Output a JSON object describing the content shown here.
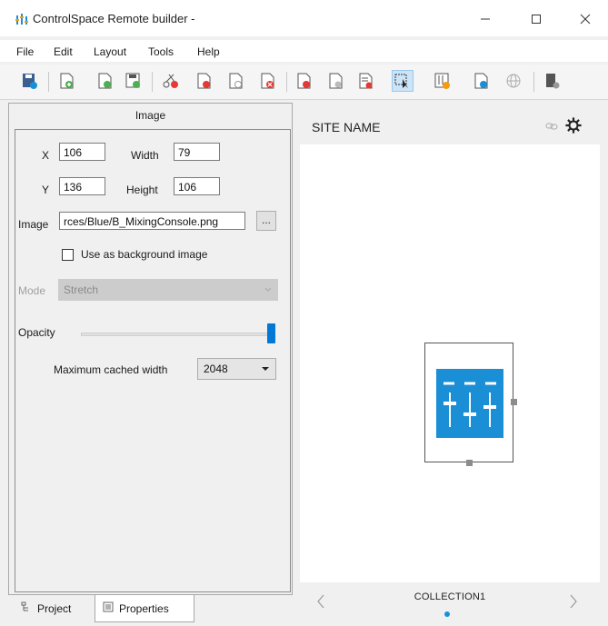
{
  "window": {
    "title": "ControlSpace Remote builder -",
    "buttons": [
      "minimize",
      "maximize",
      "close"
    ]
  },
  "menu": [
    "File",
    "Edit",
    "Layout",
    "Tools",
    "Help"
  ],
  "toolbar": {
    "icons": [
      "save-as",
      "new-page",
      "new-page-green",
      "save",
      "cut",
      "add-page-red",
      "page-blank",
      "delete-page",
      "page-red",
      "page-gray",
      "page-list",
      "select-tool",
      "mixer-orange",
      "page-blue",
      "globe",
      "device"
    ],
    "active_icon": "select-tool"
  },
  "properties": {
    "header": "Image",
    "x_label": "X",
    "x_value": "106",
    "width_label": "Width",
    "width_value": "79",
    "y_label": "Y",
    "y_value": "136",
    "height_label": "Height",
    "height_value": "106",
    "image_label": "Image",
    "image_value": "rces/Blue/B_MixingConsole.png",
    "browse_label": "...",
    "background_checkbox_label": "Use as background image",
    "background_checked": false,
    "mode_label": "Mode",
    "mode_value": "Stretch",
    "opacity_label": "Opacity",
    "opacity_fraction": 1.0,
    "max_width_label": "Maximum cached width",
    "max_width_value": "2048"
  },
  "bottom_tabs": [
    {
      "label": "Project",
      "active": false
    },
    {
      "label": "Properties",
      "active": true
    }
  ],
  "preview": {
    "site_name": "SITE NAME",
    "collection": "COLLECTION1",
    "widget_color": "#1a8fd6"
  }
}
